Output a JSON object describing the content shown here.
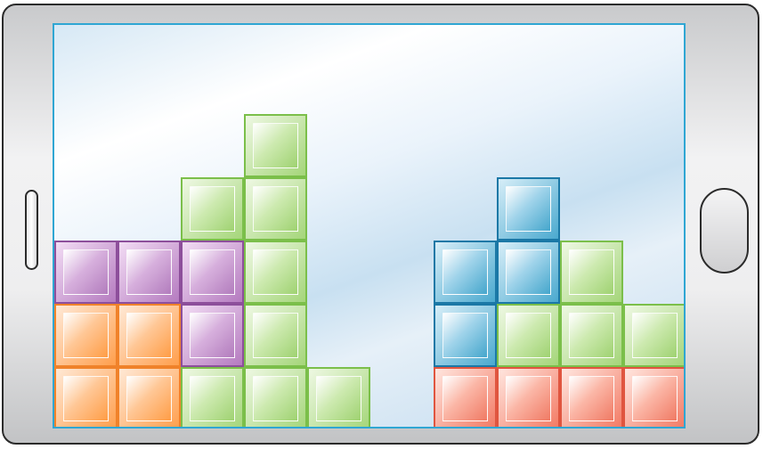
{
  "device": {
    "frame_color": "#2b2b2b",
    "body_color": "#e6e6e8",
    "left_control_icon": "side-slot-icon",
    "right_control_icon": "home-button-icon"
  },
  "board": {
    "columns": 10,
    "rows": 6,
    "border_color": "#2fa6d3",
    "colors": {
      "orange": "#ff9f4d",
      "purple": "#b57bc0",
      "green": "#a5d67a",
      "blue": "#4aa9cf",
      "red": "#f37a64"
    },
    "grid": [
      [
        null,
        null,
        null,
        "green",
        null,
        null,
        null,
        null,
        null,
        null
      ],
      [
        null,
        null,
        "green",
        "green",
        null,
        null,
        null,
        "blue",
        null,
        null
      ],
      [
        "purple",
        "purple",
        "purple",
        "green",
        null,
        null,
        "blue",
        "blue",
        "green",
        null
      ],
      [
        "orange",
        "orange",
        "purple",
        "green",
        null,
        null,
        "blue",
        "green",
        "green",
        "green"
      ],
      [
        "orange",
        "orange",
        "green",
        "green",
        "green",
        null,
        "red",
        "red",
        "red",
        "red"
      ]
    ]
  }
}
